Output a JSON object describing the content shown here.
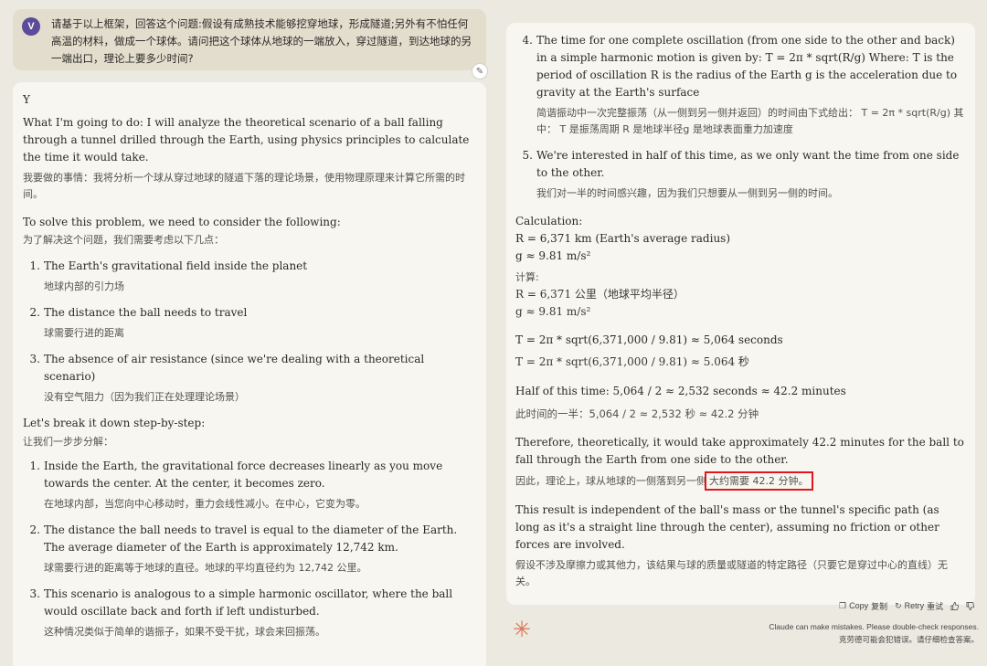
{
  "user": {
    "avatar": "V",
    "question": "请基于以上框架，回答这个问题:假设有成熟技术能够挖穿地球，形成隧道;另外有不怕任何高温的材料，做成一个球体。请问把这个球体从地球的一端放入，穿过隧道，到达地球的另一端出口，理论上要多少时间?"
  },
  "left_response": {
    "y": "Y",
    "intro_en": "What I'm going to do: I will analyze the theoretical scenario of a ball falling through a tunnel drilled through the Earth, using physics principles to calculate the time it would take.",
    "intro_zh": "我要做的事情：我将分析一个球从穿过地球的隧道下落的理论场景，使用物理原理来计算它所需的时间。",
    "consider_en": "To solve this problem, we need to consider the following:",
    "consider_zh": "为了解决这个问题，我们需要考虑以下几点：",
    "consider_items": [
      {
        "num": "1.",
        "en": "The Earth's gravitational field inside the planet",
        "zh": "地球内部的引力场"
      },
      {
        "num": "2.",
        "en": "The distance the ball needs to travel",
        "zh": "球需要行进的距离"
      },
      {
        "num": "3.",
        "en": "The absence of air resistance (since we're dealing with a theoretical scenario)",
        "zh": "没有空气阻力（因为我们正在处理理论场景）"
      }
    ],
    "steps_en": "Let's break it down step-by-step:",
    "steps_zh": "让我们一步步分解：",
    "steps": [
      {
        "num": "1.",
        "en": "Inside the Earth, the gravitational force decreases linearly as you move towards the center. At the center, it becomes zero.",
        "zh": "在地球内部，当您向中心移动时，重力会线性减小。在中心，它变为零。"
      },
      {
        "num": "2.",
        "en": "The distance the ball needs to travel is equal to the diameter of the Earth. The average diameter of the Earth is approximately 12,742 km.",
        "zh": "球需要行进的距离等于地球的直径。地球的平均直径约为 12,742 公里。"
      },
      {
        "num": "3.",
        "en": "This scenario is analogous to a simple harmonic oscillator, where the ball would oscillate back and forth if left undisturbed.",
        "zh": "这种情况类似于简单的谐振子，如果不受干扰，球会来回振荡。"
      }
    ]
  },
  "right_response": {
    "step4_num": "4.",
    "step4_en": "The time for one complete oscillation (from one side to the other and back) in a simple harmonic motion is given by: T = 2π * sqrt(R/g) Where: T is the period of oscillation R is the radius of the Earth g is the acceleration due to gravity at the Earth's surface",
    "step4_zh": "简谐振动中一次完整振荡（从一侧到另一侧并返回）的时间由下式给出： T = 2π * sqrt(R/g) 其中： T 是振荡周期 R 是地球半径g 是地球表面重力加速度",
    "step5_num": "5.",
    "step5_en": "We're interested in half of this time, as we only want the time from one side to the other.",
    "step5_zh": "我们对一半的时间感兴趣，因为我们只想要从一侧到另一侧的时间。",
    "calc_title": "Calculation:",
    "calc_r": "R = 6,371 km (Earth's average radius)",
    "calc_g": "g ≈ 9.81 m/s²",
    "calc_title_zh": "计算:",
    "calc_r_zh": "R = 6,371 公里（地球平均半径）",
    "calc_g_zh": "g ≈ 9.81 m/s²",
    "t_en": "T = 2π * sqrt(6,371,000 / 9.81) ≈ 5,064 seconds",
    "t_zh": "T = 2π * sqrt(6,371,000 / 9.81) ≈ 5.064 秒",
    "half_en": "Half of this time: 5,064 / 2 ≈ 2,532 seconds ≈ 42.2 minutes",
    "half_zh": "此时间的一半：5,064 / 2 ≈ 2,532 秒 ≈ 42.2 分钟",
    "conclusion_en": "Therefore, theoretically, it would take approximately 42.2 minutes for the ball to fall through the Earth from one side to the other.",
    "conclusion_zh_a": "因此，理论上，球从地球的一侧落到另一侧",
    "conclusion_zh_b": "大约需要 42.2 分钟。",
    "indep_en": "This result is independent of the ball's mass or the tunnel's specific path (as long as it's a straight line through the center), assuming no friction or other forces are involved.",
    "indep_zh": "假设不涉及摩擦力或其他力，该结果与球的质量或隧道的特定路径（只要它是穿过中心的直线）无关。"
  },
  "actions": {
    "copy": "Copy",
    "copy_zh": "复制",
    "retry": "Retry",
    "retry_zh": "重试"
  },
  "disclaimer": {
    "en": "Claude can make mistakes. Please double-check responses.",
    "zh": "克劳德可能会犯错误。请仔细检查答案。"
  },
  "colors": {
    "accent": "#d97757",
    "highlight": "#e0161c",
    "avatar": "#5b4b9a"
  }
}
